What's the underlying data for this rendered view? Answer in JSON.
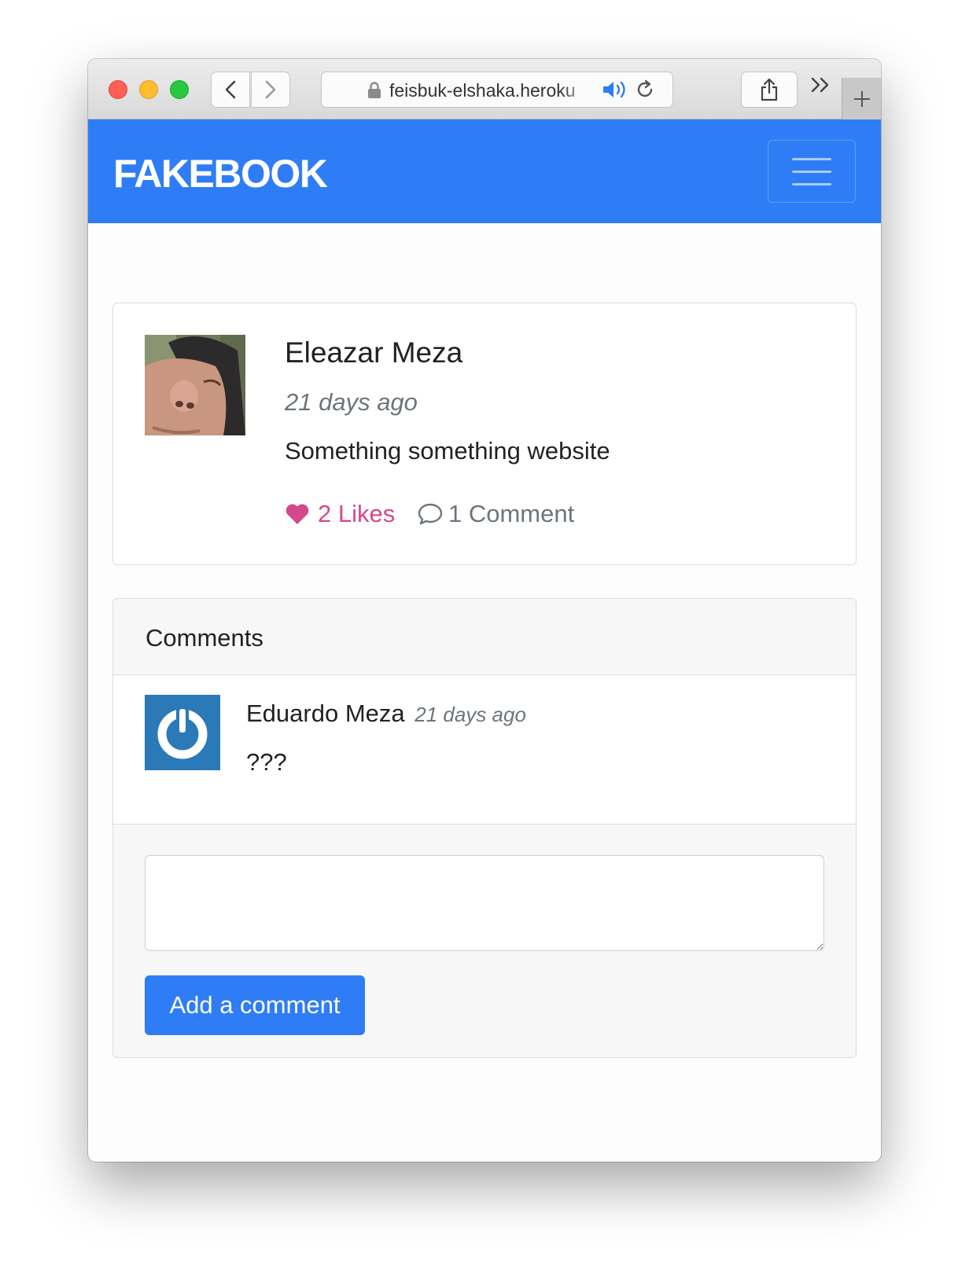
{
  "browser": {
    "url": "feisbuk-elshaka.heroku"
  },
  "navbar": {
    "brand": "FAKEBOOK"
  },
  "post": {
    "author": "Eleazar Meza",
    "time": "21 days ago",
    "body": "Something something website",
    "likes_label": "2 Likes",
    "comments_label": "1 Comment",
    "likes_color": "#d6488d"
  },
  "comments": {
    "header": "Comments",
    "items": [
      {
        "author": "Eduardo Meza",
        "time": "21 days ago",
        "text": "???"
      }
    ],
    "textarea_value": "",
    "submit_label": "Add a comment"
  },
  "colors": {
    "primary": "#2f7df6"
  }
}
